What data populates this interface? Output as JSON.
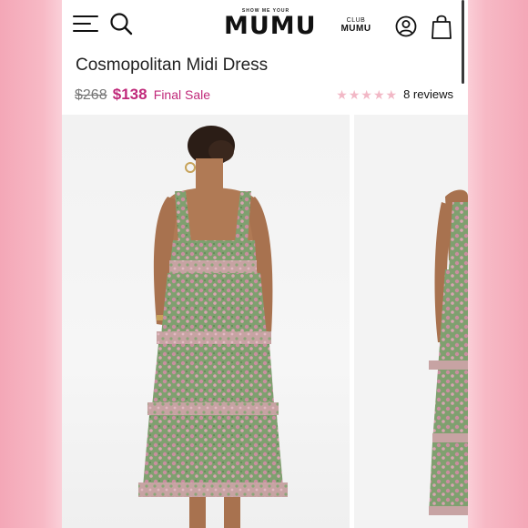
{
  "header": {
    "menu_icon": "hamburger-menu-icon",
    "search_icon": "search-icon",
    "logo_tagline": "SHOW ME YOUR",
    "logo_name": "MUMU",
    "club_top": "CLUB",
    "club_bottom": "MUMU",
    "account_icon": "account-icon",
    "bag_icon": "shopping-bag-icon"
  },
  "product": {
    "title": "Cosmopolitan Midi Dress",
    "original_price": "$268",
    "sale_price": "$138",
    "sale_label": "Final Sale",
    "rating_value": 5,
    "reviews_label": "8 reviews"
  },
  "colors": {
    "accent": "#c0297a",
    "star": "#f2b8c6",
    "background_pink": "#f7b9c5"
  }
}
